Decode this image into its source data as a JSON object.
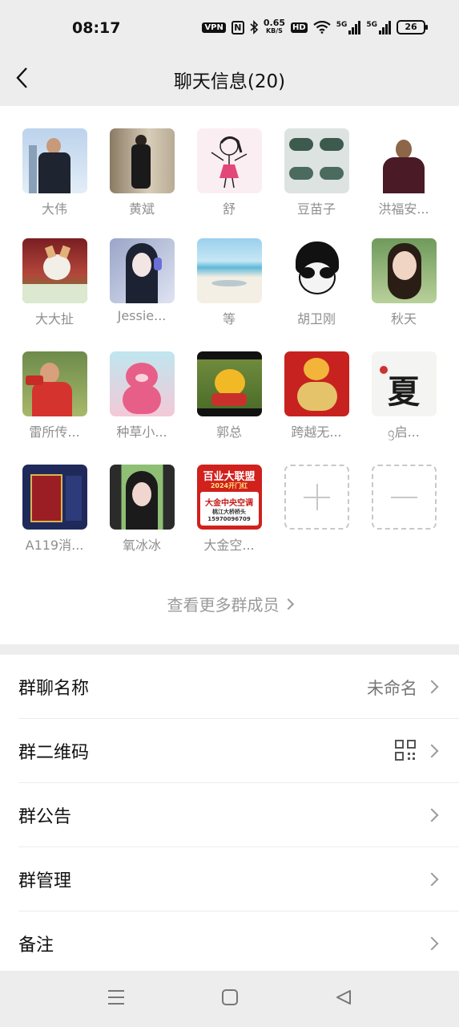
{
  "status_bar": {
    "time": "08:17",
    "vpn": "VPN",
    "nfc": "N",
    "speed_value": "0.65",
    "speed_unit": "KB/S",
    "hd": "HD",
    "signal1": "5G",
    "signal2": "5G",
    "battery": "26"
  },
  "nav": {
    "title": "聊天信息(20)"
  },
  "members": [
    {
      "name": "大伟"
    },
    {
      "name": "黄斌"
    },
    {
      "name": "舒"
    },
    {
      "name": "豆苗子"
    },
    {
      "name": "洪福安..."
    },
    {
      "name": "大大扯"
    },
    {
      "name": "Jessie..."
    },
    {
      "name": "等"
    },
    {
      "name": "胡卫刚"
    },
    {
      "name": "秋天"
    },
    {
      "name": "雷所传..."
    },
    {
      "name": "种草小..."
    },
    {
      "name": "郭总"
    },
    {
      "name": "跨越无..."
    },
    {
      "name": "ᦋ启..."
    },
    {
      "name": "A119消..."
    },
    {
      "name": "氧冰冰"
    },
    {
      "name": "大金空..."
    }
  ],
  "avatar_text": {
    "xia": "夏",
    "ad_top": "百业大联盟",
    "ad_mid": "2024开门红",
    "ad_main": "大金中央空调",
    "ad_sub": "桃江大桥桥头",
    "ad_phone": "15970096709"
  },
  "view_more": "查看更多群成员",
  "settings": {
    "group_name_label": "群聊名称",
    "group_name_value": "未命名",
    "qr_label": "群二维码",
    "notice_label": "群公告",
    "manage_label": "群管理",
    "remark_label": "备注"
  },
  "colors": {
    "background": "#ededed",
    "panel": "#ffffff",
    "secondary_text": "#8f8f8f"
  }
}
